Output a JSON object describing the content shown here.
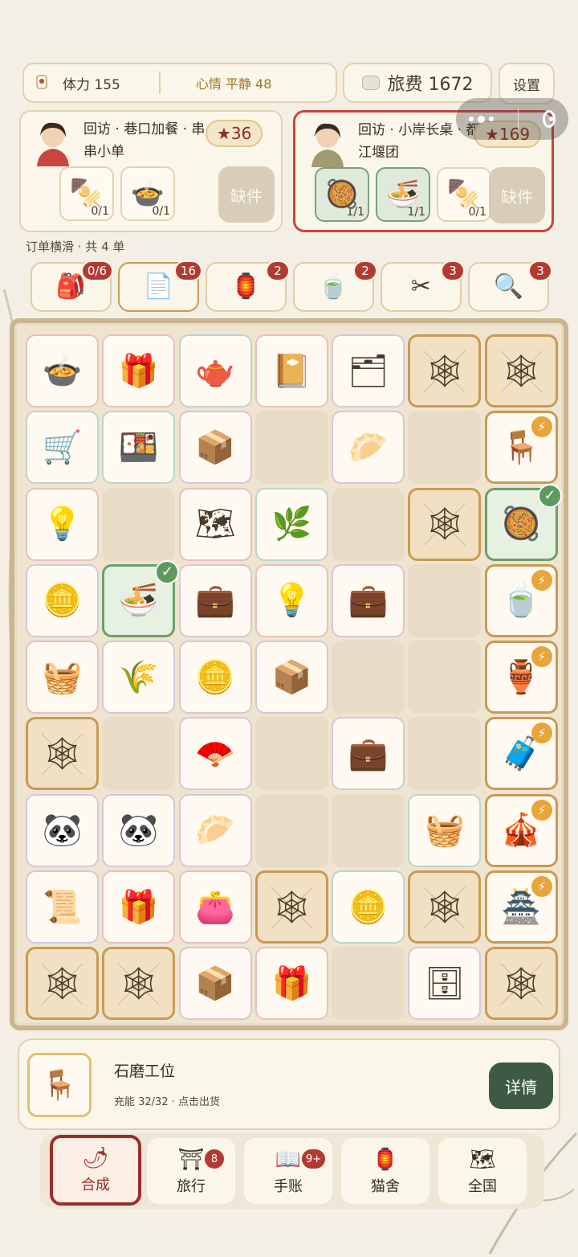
{
  "status": {
    "stamina": "体力 155",
    "mood": "心情 平静 48",
    "fare": "旅费 1672",
    "settings": "设置"
  },
  "orders": [
    {
      "title": "回访 · 巷口加餐 · 串串小单",
      "stars": "★36",
      "items": [
        {
          "icon": "skewers-icon",
          "glyph": "🍢",
          "count": "0/1",
          "done": false
        },
        {
          "icon": "spicy-hotpot-bowl-icon",
          "glyph": "🍲",
          "count": "0/1",
          "done": false
        }
      ],
      "missing": "缺件"
    },
    {
      "title": "回访 · 小岸长桌 · 都江堰团",
      "stars": "★169",
      "items": [
        {
          "icon": "copper-hotpot-icon",
          "glyph": "🥘",
          "count": "1/1",
          "done": true
        },
        {
          "icon": "noodle-bowl-icon",
          "glyph": "🍜",
          "count": "1/1",
          "done": true
        },
        {
          "icon": "skewer-pot-icon",
          "glyph": "🍢",
          "count": "0/1",
          "done": false
        }
      ],
      "missing": "缺件"
    }
  ],
  "orders_hint": "订单横滑 · 共 4 单",
  "categories": [
    {
      "icon": "backpack-icon",
      "glyph": "🎒",
      "badge": "0/6"
    },
    {
      "icon": "blank-note-icon",
      "glyph": "📄",
      "badge": "16"
    },
    {
      "icon": "lantern-ornament-icon",
      "glyph": "🏮",
      "badge": "2"
    },
    {
      "icon": "tea-bowl-icon",
      "glyph": "🍵",
      "badge": "2"
    },
    {
      "icon": "scissors-icon",
      "glyph": "✂",
      "badge": "3"
    },
    {
      "icon": "magnifier-icon",
      "glyph": "🔍",
      "badge": "3"
    }
  ],
  "board": [
    [
      {
        "t": "item",
        "b": "pink",
        "g": "🍲",
        "n": "hotpot-icon"
      },
      {
        "t": "item",
        "b": "pink",
        "g": "🎁",
        "n": "gift-bundle-icon"
      },
      {
        "t": "item",
        "b": "cyan",
        "g": "🫖",
        "n": "tea-set-icon"
      },
      {
        "t": "item",
        "b": "pink",
        "g": "📔",
        "n": "travel-journal-icon"
      },
      {
        "t": "item",
        "b": "violet",
        "g": "🗂",
        "n": "sticker-sheet-icon"
      },
      {
        "t": "web",
        "g": "🕸",
        "n": "webbed-crate-icon"
      },
      {
        "t": "web",
        "g": "🕸",
        "n": "webbed-bag-icon"
      }
    ],
    [
      {
        "t": "item",
        "b": "cyan",
        "g": "🛒",
        "n": "food-cart-icon"
      },
      {
        "t": "item",
        "b": "cyan",
        "g": "🍱",
        "n": "bento-box-icon"
      },
      {
        "t": "item",
        "b": "violet",
        "g": "📦",
        "n": "parcel-icon"
      },
      {
        "t": "empty"
      },
      {
        "t": "item",
        "b": "violet",
        "g": "🥟",
        "n": "dumpling-plate-icon"
      },
      {
        "t": "empty"
      },
      {
        "t": "gen",
        "g": "🪑",
        "n": "stone-mill-station-icon",
        "bolt": true
      }
    ],
    [
      {
        "t": "item",
        "b": "pink",
        "g": "💡",
        "n": "idea-sketch-icon"
      },
      {
        "t": "empty"
      },
      {
        "t": "item",
        "b": "pink",
        "g": "🗺",
        "n": "map-icon"
      },
      {
        "t": "item",
        "b": "cyan",
        "g": "🌿",
        "n": "tea-leaf-icon"
      },
      {
        "t": "empty"
      },
      {
        "t": "web",
        "g": "🕸",
        "n": "webbed-dish-icon"
      },
      {
        "t": "ready",
        "g": "🥘",
        "n": "copper-hotpot-icon",
        "check": true
      }
    ],
    [
      {
        "t": "item",
        "b": "violet",
        "g": "🪙",
        "n": "coin-knot-icon"
      },
      {
        "t": "ready",
        "g": "🍜",
        "n": "noodle-bowl-icon",
        "check": true
      },
      {
        "t": "item",
        "b": "violet",
        "g": "💼",
        "n": "suitcase-icon"
      },
      {
        "t": "item",
        "b": "pink",
        "g": "💡",
        "n": "idea-sketch-icon"
      },
      {
        "t": "item",
        "b": "violet",
        "g": "💼",
        "n": "suitcase-icon"
      },
      {
        "t": "empty"
      },
      {
        "t": "gen",
        "g": "🍵",
        "n": "tea-stall-icon",
        "bolt": true
      }
    ],
    [
      {
        "t": "item",
        "b": "pink",
        "g": "🧺",
        "n": "steamer-basket-icon"
      },
      {
        "t": "item",
        "b": "violet",
        "g": "🌾",
        "n": "wheat-icon"
      },
      {
        "t": "item",
        "b": "violet",
        "g": "🪙",
        "n": "ancient-coin-icon"
      },
      {
        "t": "item",
        "b": "violet",
        "g": "📦",
        "n": "parcel-icon"
      },
      {
        "t": "empty"
      },
      {
        "t": "empty"
      },
      {
        "t": "gen",
        "g": "🏺",
        "n": "pottery-stall-icon",
        "bolt": true
      }
    ],
    [
      {
        "t": "web",
        "g": "🕸",
        "n": "webbed-wallet-icon"
      },
      {
        "t": "empty"
      },
      {
        "t": "item",
        "b": "violet",
        "g": "🪭",
        "n": "panda-fan-icon"
      },
      {
        "t": "empty"
      },
      {
        "t": "item",
        "b": "violet",
        "g": "💼",
        "n": "suitcase-icon"
      },
      {
        "t": "empty"
      },
      {
        "t": "gen",
        "g": "🧳",
        "n": "trunk-workshop-icon",
        "bolt": true
      }
    ],
    [
      {
        "t": "item",
        "b": "violet",
        "g": "🐼",
        "n": "panda-head-icon"
      },
      {
        "t": "item",
        "b": "violet",
        "g": "🐼",
        "n": "panda-bamboo-icon"
      },
      {
        "t": "item",
        "b": "violet",
        "g": "🥟",
        "n": "wonton-bowl-icon"
      },
      {
        "t": "empty"
      },
      {
        "t": "empty"
      },
      {
        "t": "item",
        "b": "cyan",
        "g": "🧺",
        "n": "tea-basket-icon"
      },
      {
        "t": "gen",
        "g": "🎪",
        "n": "panda-booth-icon",
        "bolt": true
      }
    ],
    [
      {
        "t": "item",
        "b": "violet",
        "g": "📜",
        "n": "brocade-scroll-icon"
      },
      {
        "t": "item",
        "b": "pink",
        "g": "🎁",
        "n": "gift-stack-icon"
      },
      {
        "t": "item",
        "b": "pink",
        "g": "👛",
        "n": "coin-pouch-icon"
      },
      {
        "t": "web",
        "g": "🕸",
        "n": "webbed-tag-icon"
      },
      {
        "t": "item",
        "b": "cyan",
        "g": "🪙",
        "n": "coin-pile-icon"
      },
      {
        "t": "web",
        "g": "🕸",
        "n": "webbed-vase-icon"
      },
      {
        "t": "gen",
        "g": "🏯",
        "n": "pavilion-workshop-icon",
        "bolt": true
      }
    ],
    [
      {
        "t": "web",
        "g": "🕸",
        "n": "webbed-bundle-icon"
      },
      {
        "t": "web",
        "g": "🕸",
        "n": "webbed-chest-icon"
      },
      {
        "t": "item",
        "b": "violet",
        "g": "📦",
        "n": "parcel-icon"
      },
      {
        "t": "item",
        "b": "pink",
        "g": "🎁",
        "n": "red-gift-icon"
      },
      {
        "t": "empty"
      },
      {
        "t": "item",
        "b": "violet",
        "g": "🗄",
        "n": "curio-cabinet-icon"
      },
      {
        "t": "web",
        "g": "🕸",
        "n": "webbed-cart-icon"
      }
    ]
  ],
  "info": {
    "title": "石磨工位",
    "sub": "充能 32/32 · 点击出货",
    "detail": "详情"
  },
  "nav": [
    {
      "label": "合成",
      "glyph": "🌶",
      "icon": "merge-icon",
      "badge": "",
      "active": true
    },
    {
      "label": "旅行",
      "glyph": "⛩",
      "icon": "travel-icon",
      "badge": "8",
      "active": false
    },
    {
      "label": "手账",
      "glyph": "📖",
      "icon": "journal-icon",
      "badge": "9+",
      "active": false
    },
    {
      "label": "猫舍",
      "glyph": "🏮",
      "icon": "cattery-icon",
      "badge": "",
      "active": false
    },
    {
      "label": "全国",
      "glyph": "🗺",
      "icon": "map-nation-icon",
      "badge": "",
      "active": false
    }
  ],
  "colors": {
    "accent_red": "#b33a32",
    "frame_gold": "#c99a55",
    "ready_green": "#5e9a5e",
    "detail_green": "#3f5a44"
  }
}
